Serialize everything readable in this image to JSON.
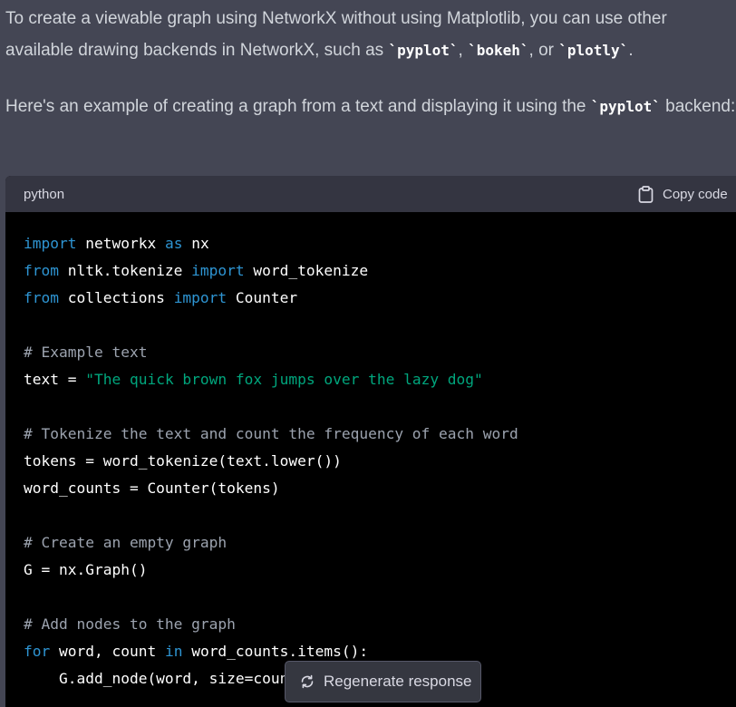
{
  "intro": {
    "p1_before": "To create a viewable graph using NetworkX without using Matplotlib, you can use other available drawing backends in NetworkX, such as ",
    "p1_code1": "`pyplot`",
    "p1_sep1": ", ",
    "p1_code2": "`bokeh`",
    "p1_sep2": ", or ",
    "p1_code3": "`plotly`",
    "p1_after": ".",
    "p2_before": "Here's an example of creating a graph from a text and displaying it using the ",
    "p2_code": "`pyplot`",
    "p2_after": " backend:"
  },
  "codeblock": {
    "language": "python",
    "copy_label": "Copy code",
    "lines": [
      [
        {
          "t": "import",
          "c": "kw"
        },
        {
          "t": " networkx "
        },
        {
          "t": "as",
          "c": "kw"
        },
        {
          "t": " nx"
        }
      ],
      [
        {
          "t": "from",
          "c": "kw"
        },
        {
          "t": " nltk.tokenize "
        },
        {
          "t": "import",
          "c": "kw"
        },
        {
          "t": " word_tokenize"
        }
      ],
      [
        {
          "t": "from",
          "c": "kw"
        },
        {
          "t": " collections "
        },
        {
          "t": "import",
          "c": "kw"
        },
        {
          "t": " Counter"
        }
      ],
      [],
      [
        {
          "t": "# Example text",
          "c": "cm"
        }
      ],
      [
        {
          "t": "text = "
        },
        {
          "t": "\"The quick brown fox jumps over the lazy dog\"",
          "c": "str"
        }
      ],
      [],
      [
        {
          "t": "# Tokenize the text and count the frequency of each word",
          "c": "cm"
        }
      ],
      [
        {
          "t": "tokens = word_tokenize(text.lower())"
        }
      ],
      [
        {
          "t": "word_counts = Counter(tokens)"
        }
      ],
      [],
      [
        {
          "t": "# Create an empty graph",
          "c": "cm"
        }
      ],
      [
        {
          "t": "G = nx.Graph()"
        }
      ],
      [],
      [
        {
          "t": "# Add nodes to the graph",
          "c": "cm"
        }
      ],
      [
        {
          "t": "for",
          "c": "kw"
        },
        {
          "t": " word, count "
        },
        {
          "t": "in",
          "c": "kw"
        },
        {
          "t": " word_counts.items():"
        }
      ],
      [
        {
          "t": "    G.add_node(word, size=count)"
        }
      ]
    ]
  },
  "regenerate": {
    "label": "Regenerate response",
    "icon": "refresh-icon"
  }
}
